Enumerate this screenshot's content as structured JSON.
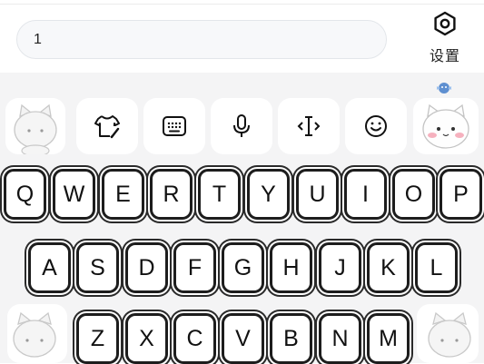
{
  "search": {
    "value": "1"
  },
  "settings": {
    "label": "设置",
    "icon": "hexagon-settings-icon"
  },
  "toolbar": {
    "items": [
      {
        "name": "kitty-sticker-left",
        "icon": "kitty-sticker-icon"
      },
      {
        "name": "theme",
        "icon": "tshirt-brush-icon"
      },
      {
        "name": "keyboard-layout",
        "icon": "keyboard-icon"
      },
      {
        "name": "voice",
        "icon": "microphone-icon"
      },
      {
        "name": "cursor-edit",
        "icon": "cursor-move-icon"
      },
      {
        "name": "emoji",
        "icon": "smiley-icon"
      },
      {
        "name": "kitty-sticker-right",
        "icon": "kitty-blush-icon"
      }
    ]
  },
  "keyboard": {
    "row1": [
      "Q",
      "W",
      "E",
      "R",
      "T",
      "Y",
      "U",
      "I",
      "O",
      "P"
    ],
    "row2": [
      "A",
      "S",
      "D",
      "F",
      "G",
      "H",
      "J",
      "K",
      "L"
    ],
    "row3": [
      "Z",
      "X",
      "C",
      "V",
      "B",
      "N",
      "M"
    ]
  },
  "colors": {
    "key_border": "#1d1d1d",
    "keyboard_bg": "#f4f4f5",
    "blush": "#f5a3b3"
  }
}
